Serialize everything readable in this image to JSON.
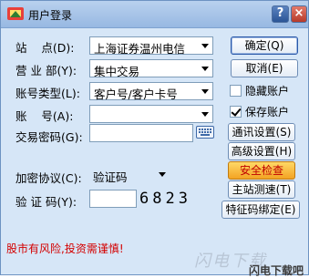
{
  "window": {
    "title": "用户登录",
    "help_label": "?",
    "close_label": "×"
  },
  "form": {
    "station": {
      "label": "站    点(D):",
      "value": "上海证券温州电信"
    },
    "branch": {
      "label": "营 业 部(Y):",
      "value": "集中交易"
    },
    "account_type": {
      "label": "账号类型(L):",
      "value": "客户号/客户卡号"
    },
    "account": {
      "label": "账    号(A):",
      "value": ""
    },
    "password": {
      "label": "交易密码(G):",
      "value": ""
    },
    "encryption": {
      "label": "加密协议(C):",
      "value": "验证码"
    },
    "captcha": {
      "label": "验 证 码(Y):",
      "value": "",
      "code": "6823"
    }
  },
  "checkboxes": {
    "hide_account": {
      "label": "隐藏账户",
      "checked": false
    },
    "save_account": {
      "label": "保存账户",
      "checked": true
    }
  },
  "buttons": {
    "confirm": "确定(Q)",
    "cancel": "取消(E)",
    "comm_settings": "通讯设置(S)",
    "advanced_settings": "高级设置(H)",
    "security_check": "安全检查",
    "speed_test": "主站测速(T)",
    "cert_bind": "特征码绑定(E)"
  },
  "footer": {
    "risk_notice": "股市有风险,投资需谨慎!",
    "watermark_a": "闪电下载",
    "watermark_b": "闪电下载吧"
  },
  "colors": {
    "window_bg": "#d6e6f7",
    "risk_text": "#d40000",
    "security_button": "#f3a323"
  }
}
